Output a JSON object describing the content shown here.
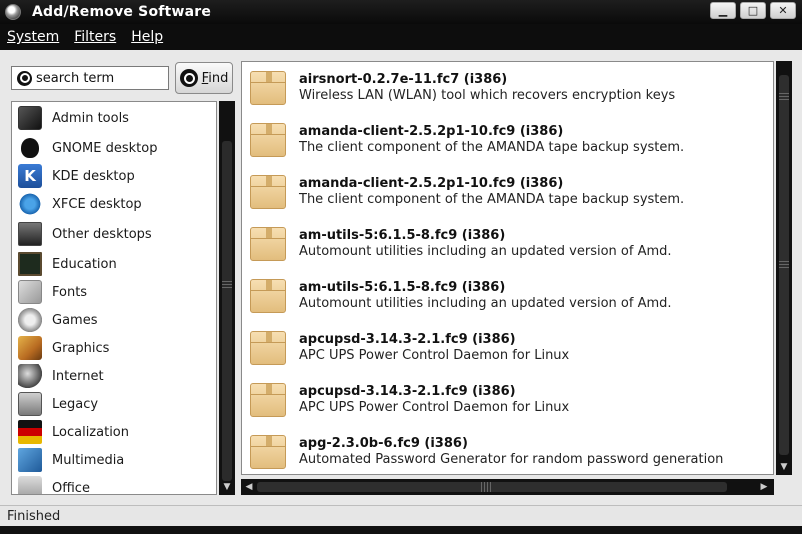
{
  "window": {
    "title": "Add/Remove Software",
    "controls": {
      "minimize": "▁",
      "maximize": "□",
      "close": "✕"
    }
  },
  "menubar": {
    "items": [
      {
        "label": "System",
        "mnemonic": "S"
      },
      {
        "label": "Filters",
        "mnemonic": "F"
      },
      {
        "label": "Help",
        "mnemonic": "H"
      }
    ]
  },
  "search": {
    "value": "search term",
    "find_label": "Find"
  },
  "categories": [
    {
      "label": "Admin tools",
      "icon": "admin-tools-icon"
    },
    {
      "label": "GNOME desktop",
      "icon": "gnome-foot-icon"
    },
    {
      "label": "KDE desktop",
      "icon": "kde-icon",
      "glyph": "K"
    },
    {
      "label": "XFCE desktop",
      "icon": "xfce-mouse-icon"
    },
    {
      "label": "Other desktops",
      "icon": "other-desktops-icon"
    },
    {
      "label": "Education",
      "icon": "chalkboard-icon"
    },
    {
      "label": "Fonts",
      "icon": "fonts-icon"
    },
    {
      "label": "Games",
      "icon": "gamepad-icon"
    },
    {
      "label": "Graphics",
      "icon": "paint-brush-icon"
    },
    {
      "label": "Internet",
      "icon": "globe-icon"
    },
    {
      "label": "Legacy",
      "icon": "legacy-icon"
    },
    {
      "label": "Localization",
      "icon": "flag-icon"
    },
    {
      "label": "Multimedia",
      "icon": "clapperboard-icon"
    },
    {
      "label": "Office",
      "icon": "office-icon"
    }
  ],
  "packages": [
    {
      "name": "airsnort-0.2.7e-11.fc7 (i386)",
      "description": "Wireless LAN (WLAN) tool which recovers encryption keys"
    },
    {
      "name": "amanda-client-2.5.2p1-10.fc9 (i386)",
      "description": "The client component of the AMANDA tape backup system."
    },
    {
      "name": "amanda-client-2.5.2p1-10.fc9 (i386)",
      "description": "The client component of the AMANDA tape backup system."
    },
    {
      "name": "am-utils-5:6.1.5-8.fc9 (i386)",
      "description": "Automount utilities including an updated version of Amd."
    },
    {
      "name": "am-utils-5:6.1.5-8.fc9 (i386)",
      "description": "Automount utilities including an updated version of Amd."
    },
    {
      "name": "apcupsd-3.14.3-2.1.fc9 (i386)",
      "description": "APC UPS Power Control Daemon for Linux"
    },
    {
      "name": "apcupsd-3.14.3-2.1.fc9 (i386)",
      "description": "APC UPS Power Control Daemon for Linux"
    },
    {
      "name": "apg-2.3.0b-6.fc9 (i386)",
      "description": "Automated Password Generator for random password generation"
    }
  ],
  "status": {
    "text": "Finished"
  }
}
